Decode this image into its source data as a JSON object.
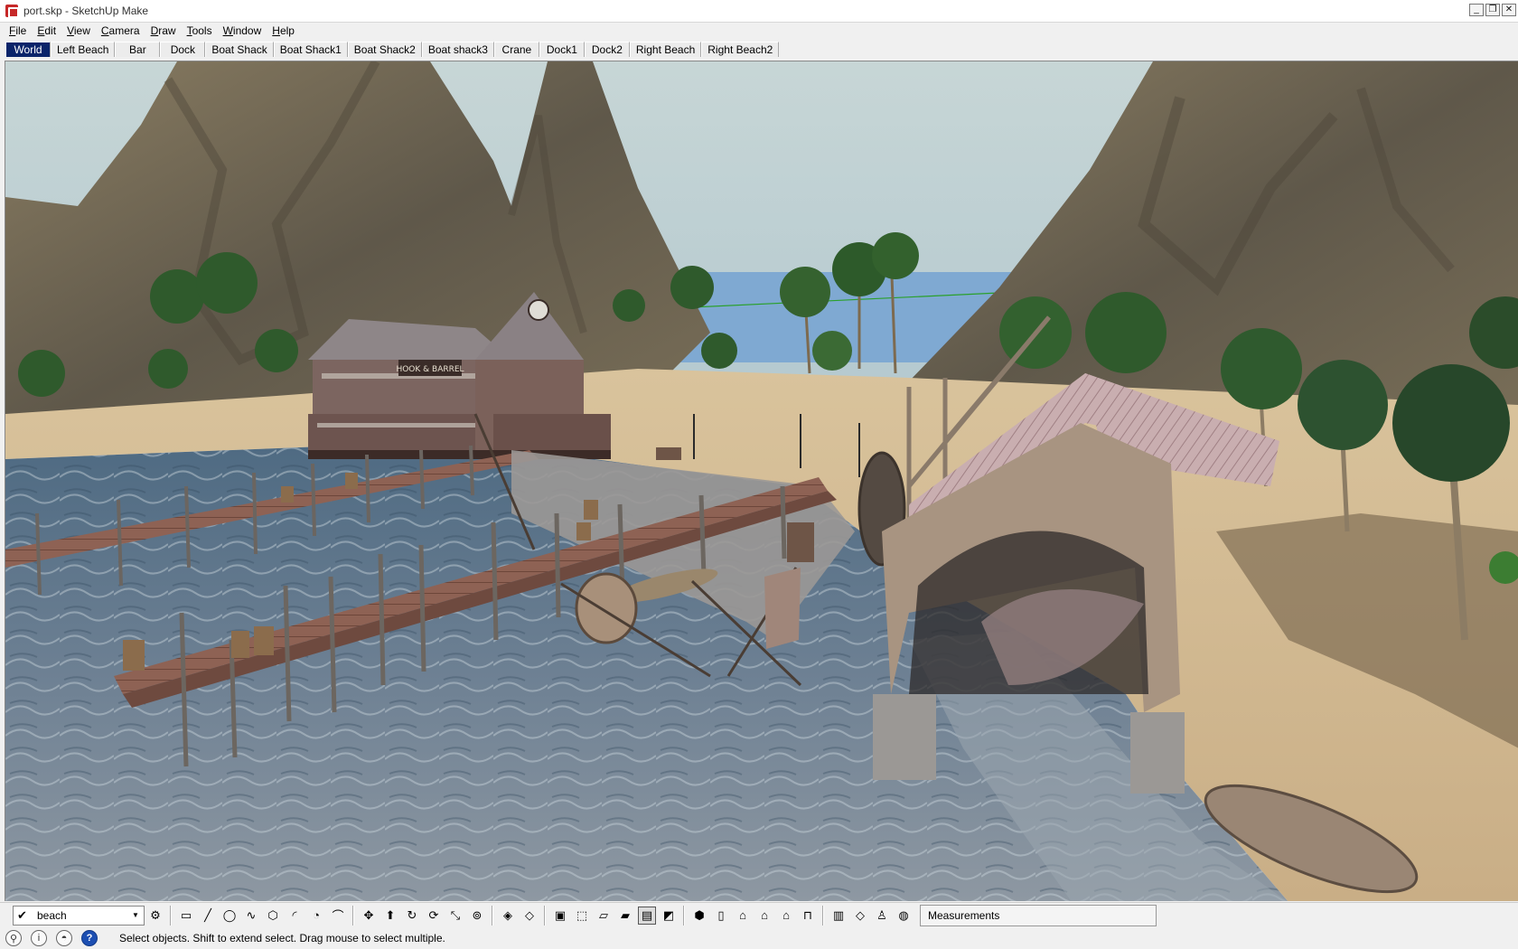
{
  "window": {
    "title": "port.skp - SketchUp Make",
    "buttons": [
      "_",
      "❐",
      "✕"
    ]
  },
  "menu": [
    {
      "label": "File",
      "key": "F"
    },
    {
      "label": "Edit",
      "key": "E"
    },
    {
      "label": "View",
      "key": "V"
    },
    {
      "label": "Camera",
      "key": "C"
    },
    {
      "label": "Draw",
      "key": "D"
    },
    {
      "label": "Tools",
      "key": "T"
    },
    {
      "label": "Window",
      "key": "W"
    },
    {
      "label": "Help",
      "key": "H"
    }
  ],
  "scenes": [
    "World",
    "Left Beach",
    "Bar",
    "Dock",
    "Boat Shack",
    "Boat Shack1",
    "Boat Shack2",
    "Boat shack3",
    "Crane",
    "Dock1",
    "Dock2",
    "Right Beach",
    "Right Beach2"
  ],
  "active_scene": "World",
  "viewport": {
    "sign_text": "HOOK & BARREL",
    "colors": {
      "sky": "#b9cdd3",
      "sea_far": "#7fa9d2",
      "water": "#5c7288",
      "sand": "#cdb48f",
      "rock": "#6e6552",
      "palm": "#2f5a2c",
      "wood": "#8d6b54",
      "roof": "#c4a7a3"
    }
  },
  "toolbar": {
    "layer": {
      "checked": "✔",
      "name": "beach"
    },
    "tools": [
      {
        "name": "layer-manager-icon",
        "glyph": "⚙"
      },
      {
        "sep": true
      },
      {
        "name": "rectangle-icon",
        "glyph": "▭"
      },
      {
        "name": "line-icon",
        "glyph": "╱"
      },
      {
        "name": "circle-icon",
        "glyph": "◯"
      },
      {
        "name": "freehand-icon",
        "glyph": "∿"
      },
      {
        "name": "polygon-icon",
        "glyph": "⬡"
      },
      {
        "name": "arc-icon",
        "glyph": "◜"
      },
      {
        "name": "pie-icon",
        "glyph": "◔"
      },
      {
        "name": "two-point-arc-icon",
        "glyph": "⌒"
      },
      {
        "sep": true
      },
      {
        "name": "move-icon",
        "glyph": "✥"
      },
      {
        "name": "push-pull-icon",
        "glyph": "⬆"
      },
      {
        "name": "rotate-icon",
        "glyph": "↻"
      },
      {
        "name": "follow-me-icon",
        "glyph": "⟳"
      },
      {
        "name": "scale-icon",
        "glyph": "⤡"
      },
      {
        "name": "offset-icon",
        "glyph": "⊚"
      },
      {
        "sep": true
      },
      {
        "name": "section-plane-icon",
        "glyph": "◈"
      },
      {
        "name": "section-fill-icon",
        "glyph": "◇"
      },
      {
        "sep": true
      },
      {
        "name": "xray-icon",
        "glyph": "▣"
      },
      {
        "name": "wireframe-icon",
        "glyph": "⬚"
      },
      {
        "name": "hidden-line-icon",
        "glyph": "▱"
      },
      {
        "name": "shaded-icon",
        "glyph": "▰"
      },
      {
        "name": "shaded-textures-icon",
        "glyph": "▤",
        "pressed": true
      },
      {
        "name": "monochrome-icon",
        "glyph": "◩"
      },
      {
        "sep": true
      },
      {
        "name": "iso-view-icon",
        "glyph": "⬢"
      },
      {
        "name": "top-view-icon",
        "glyph": "▯"
      },
      {
        "name": "front-view-icon",
        "glyph": "⌂"
      },
      {
        "name": "right-view-icon",
        "glyph": "⌂"
      },
      {
        "name": "back-view-icon",
        "glyph": "⌂"
      },
      {
        "name": "left-view-icon",
        "glyph": "⊓"
      },
      {
        "sep": true
      },
      {
        "name": "3d-warehouse-icon",
        "glyph": "▥"
      },
      {
        "name": "share-component-icon",
        "glyph": "◇"
      },
      {
        "name": "extension-warehouse-icon",
        "glyph": "♙"
      },
      {
        "name": "geo-location-icon",
        "glyph": "◍"
      }
    ],
    "measurements_label": "Measurements"
  },
  "statusbar": {
    "icons": [
      {
        "name": "geolocation-status-icon",
        "glyph": "⚲"
      },
      {
        "name": "credits-status-icon",
        "glyph": "i"
      },
      {
        "name": "user-status-icon",
        "glyph": "◓"
      },
      {
        "name": "help-status-icon",
        "glyph": "?"
      }
    ],
    "message": "Select objects. Shift to extend select. Drag mouse to select multiple."
  }
}
